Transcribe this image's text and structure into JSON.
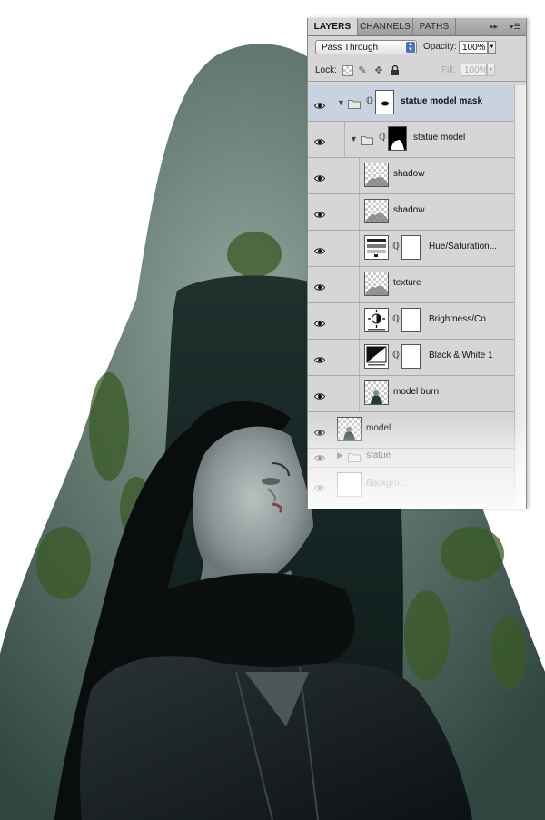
{
  "panel": {
    "tabs": [
      {
        "label": "LAYERS",
        "active": true
      },
      {
        "label": "CHANNELS",
        "active": false
      },
      {
        "label": "PATHS",
        "active": false
      }
    ],
    "menu_icons": [
      "forward-arrows-icon",
      "panel-menu-icon"
    ],
    "blend_mode": "Pass Through",
    "opacity_label": "Opacity:",
    "opacity_value": "100%",
    "lock_label": "Lock:",
    "lock_icons": [
      "lock-transparent-icon",
      "lock-paint-icon",
      "lock-move-icon",
      "lock-all-icon"
    ],
    "fill_label": "Fill:",
    "fill_value": "100%"
  },
  "layers": [
    {
      "name": "statue model mask",
      "type": "group",
      "expanded": true,
      "selected": true,
      "indent": 0,
      "has_mask": true,
      "bold": true
    },
    {
      "name": "statue model",
      "type": "group",
      "expanded": true,
      "selected": false,
      "indent": 1,
      "has_mask": true
    },
    {
      "name": "shadow",
      "type": "pixel",
      "indent": 2
    },
    {
      "name": "shadow",
      "type": "pixel",
      "indent": 2
    },
    {
      "name": "Hue/Saturation...",
      "type": "adjustment",
      "adj_icon": "hue-saturation-icon",
      "indent": 2
    },
    {
      "name": "texture",
      "type": "pixel",
      "indent": 2
    },
    {
      "name": "Brightness/Co...",
      "type": "adjustment",
      "adj_icon": "brightness-contrast-icon",
      "indent": 2
    },
    {
      "name": "Black & White 1",
      "type": "adjustment",
      "adj_icon": "black-white-icon",
      "indent": 2
    },
    {
      "name": "model burn",
      "type": "pixel",
      "indent": 2
    },
    {
      "name": "model",
      "type": "pixel",
      "indent": 0
    },
    {
      "name": "statue",
      "type": "group",
      "expanded": false,
      "indent": 0
    },
    {
      "name": "Backgro...",
      "type": "background",
      "indent": 0
    }
  ]
}
